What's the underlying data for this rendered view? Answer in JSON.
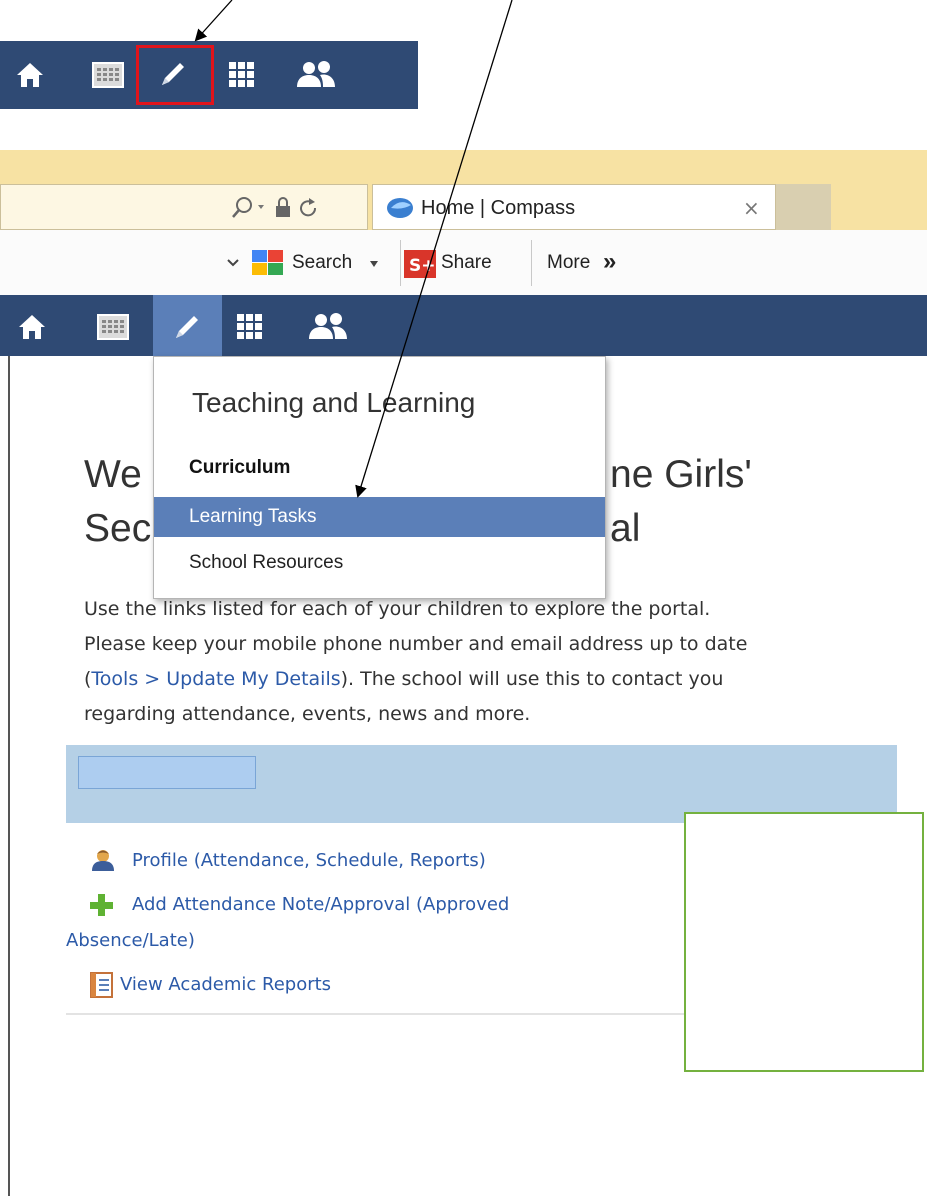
{
  "nav": {
    "items": [
      {
        "icon": "home-icon"
      },
      {
        "icon": "calendar-icon"
      },
      {
        "icon": "pencil-icon"
      },
      {
        "icon": "grid-icon"
      },
      {
        "icon": "people-icon"
      }
    ],
    "highlight_color": "#e0141b",
    "bar_color": "#2f4a74",
    "active_color": "#5b7fb8"
  },
  "browser": {
    "tab_title": "Home | Compass",
    "tab_close": "×",
    "toolbar": {
      "search_label": "Search",
      "share_label": "Share",
      "more_label": "More",
      "more_glyph": "»"
    }
  },
  "dropdown": {
    "title": "Teaching and Learning",
    "section": "Curriculum",
    "items": [
      "Learning Tasks",
      "School Resources"
    ]
  },
  "page": {
    "welcome_line1_left": "We",
    "welcome_line1_right": "ne Girls'",
    "welcome_line2_left": "Sec",
    "welcome_line2_right": "al",
    "para_intro": "Use the links listed for each of your children to explore the portal.",
    "para_2": "Please keep your mobile phone number and email address up to date",
    "para_paren_open": "(",
    "para_link": "Tools > Update My Details",
    "para_3": "). The school will use this to contact you",
    "para_4": "regarding attendance, events, news and more."
  },
  "links": [
    {
      "icon": "profile-icon",
      "label": "Profile (Attendance, Schedule, Reports)"
    },
    {
      "icon": "plus-icon",
      "label": "Add Attendance Note/Approval (Approved",
      "label_cont": "Absence/Late)"
    },
    {
      "icon": "report-icon",
      "label": "View Academic Reports"
    }
  ]
}
